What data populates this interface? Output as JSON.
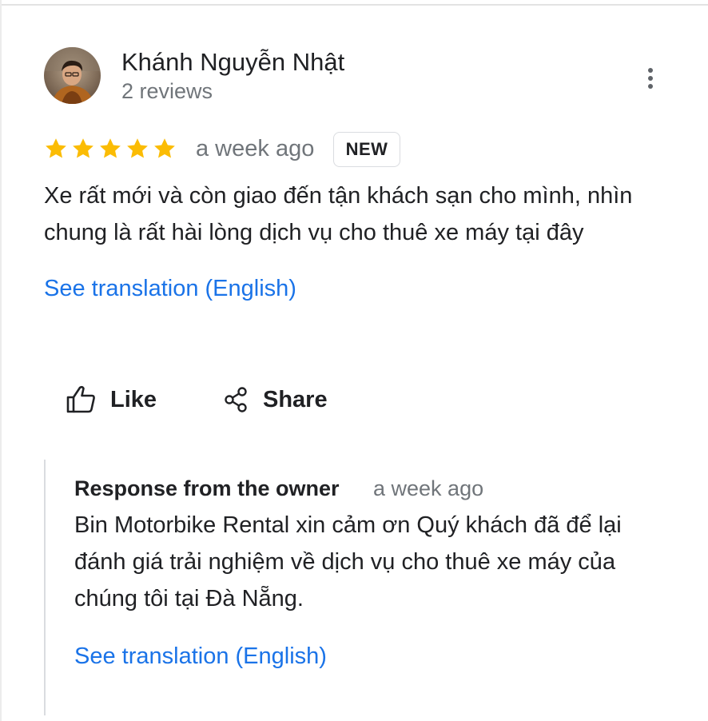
{
  "review": {
    "author_name": "Khánh Nguyễn Nhật",
    "author_reviews": "2 reviews",
    "rating": 5,
    "max_rating": 5,
    "time": "a week ago",
    "badge": "NEW",
    "text": "Xe rất mới và còn giao đến tận khách sạn cho mình, nhìn chung là rất hài lòng dịch vụ cho thuê xe máy tại đây",
    "translate_label": "See translation (English)"
  },
  "actions": {
    "like_label": "Like",
    "share_label": "Share"
  },
  "owner_response": {
    "title": "Response from the owner",
    "time": "a week ago",
    "text": "Bin Motorbike Rental xin cảm ơn Quý khách đã để lại đánh giá trải nghiệm về dịch vụ cho thuê xe máy của chúng tôi tại Đà Nẵng.",
    "translate_label": "See translation (English)"
  },
  "colors": {
    "star": "#fbbc04",
    "link": "#1a73e8",
    "text": "#202124",
    "secondary": "#70757a"
  },
  "icons": {
    "more": "more-vert-icon",
    "like": "thumb-up-icon",
    "share": "share-icon",
    "star": "star-icon"
  }
}
